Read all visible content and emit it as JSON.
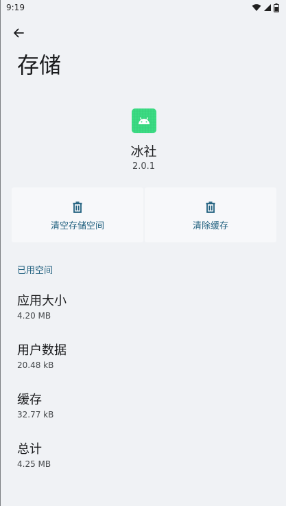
{
  "status_bar": {
    "time": "9:19",
    "icons": [
      "wifi-icon",
      "signal-icon",
      "battery-icon"
    ]
  },
  "toolbar": {
    "back_icon": "arrow-back-icon"
  },
  "page": {
    "title": "存储"
  },
  "app": {
    "name": "冰社",
    "version": "2.0.1",
    "icon": "android-icon",
    "icon_color": "#3ddc84"
  },
  "actions": [
    {
      "label": "清空存储空间",
      "icon": "trash-icon"
    },
    {
      "label": "清除缓存",
      "icon": "trash-icon"
    }
  ],
  "section": {
    "header": "已用空间",
    "items": [
      {
        "title": "应用大小",
        "summary": "4.20 MB"
      },
      {
        "title": "用户数据",
        "summary": "20.48 kB"
      },
      {
        "title": "缓存",
        "summary": "32.77 kB"
      },
      {
        "title": "总计",
        "summary": "4.25 MB"
      }
    ]
  },
  "colors": {
    "accent": "#1f5f7e",
    "background": "#f0f2f5",
    "button_bg": "#f7f8fa"
  }
}
